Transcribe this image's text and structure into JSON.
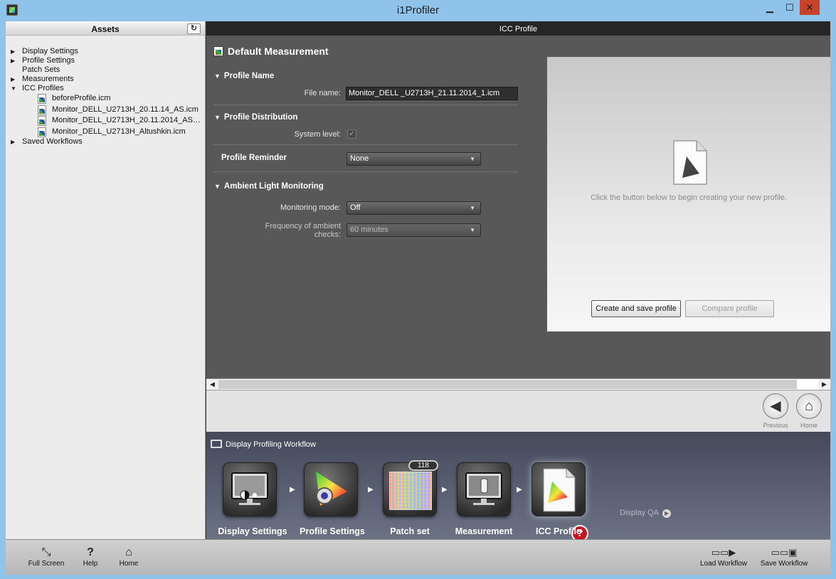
{
  "window": {
    "title": "i1Profiler",
    "minimize": "▁",
    "maximize": "☐",
    "close": "✕"
  },
  "assets": {
    "title": "Assets",
    "refresh_icon": "↻",
    "tree": [
      {
        "label": "Display Settings",
        "expanded": false
      },
      {
        "label": "Profile Settings",
        "expanded": false
      },
      {
        "label": "Patch Sets",
        "expanded": null
      },
      {
        "label": "Measurements",
        "expanded": false
      },
      {
        "label": "ICC Profiles",
        "expanded": true
      },
      {
        "label": "Saved Workflows",
        "expanded": false
      }
    ],
    "icc_files": [
      "beforeProfile.icm",
      "Monitor_DELL_U2713H_20.11.14_AS.icm",
      "Monitor_DELL_U2713H_20.11.2014_AS_...",
      "Monitor_DELL_U2713H_Altushkin.icm"
    ]
  },
  "panel": {
    "header": "ICC Profile",
    "title": "Default Measurement",
    "profile_name": {
      "section": "Profile Name",
      "file_label": "File name:",
      "file_value": "Monitor_DELL _U2713H_21.11.2014_1.icm"
    },
    "distribution": {
      "section": "Profile Distribution",
      "system_label": "System level:",
      "system_checked": true
    },
    "reminder": {
      "section": "Profile Reminder",
      "value": "None"
    },
    "ambient": {
      "section": "Ambient Light Monitoring",
      "mode_label": "Monitoring mode:",
      "mode_value": "Off",
      "freq_label_1": "Frequency of ambient",
      "freq_label_2": "checks:",
      "freq_value": "60 minutes"
    },
    "preview": {
      "hint": "Click the button below to begin creating your new profile.",
      "create_button": "Create and save profile",
      "compare_button": "Compare profile"
    }
  },
  "nav": {
    "previous": "Previous",
    "home": "Home"
  },
  "workflow": {
    "title": "Display Profiling Workflow",
    "steps": [
      "Display Settings",
      "Profile Settings",
      "Patch set",
      "Measurement",
      "ICC Profile"
    ],
    "patch_count": "118",
    "next": "Display QA"
  },
  "toolbar": {
    "full_screen": "Full Screen",
    "help": "Help",
    "home": "Home",
    "load": "Load Workflow",
    "save": "Save Workflow"
  },
  "colors": {
    "title_bar": "#8fc3ea",
    "close_button": "#c7412b",
    "panel_bg": "#585858",
    "workflow_bg": "#555b6c",
    "error_badge": "#c8141e"
  }
}
